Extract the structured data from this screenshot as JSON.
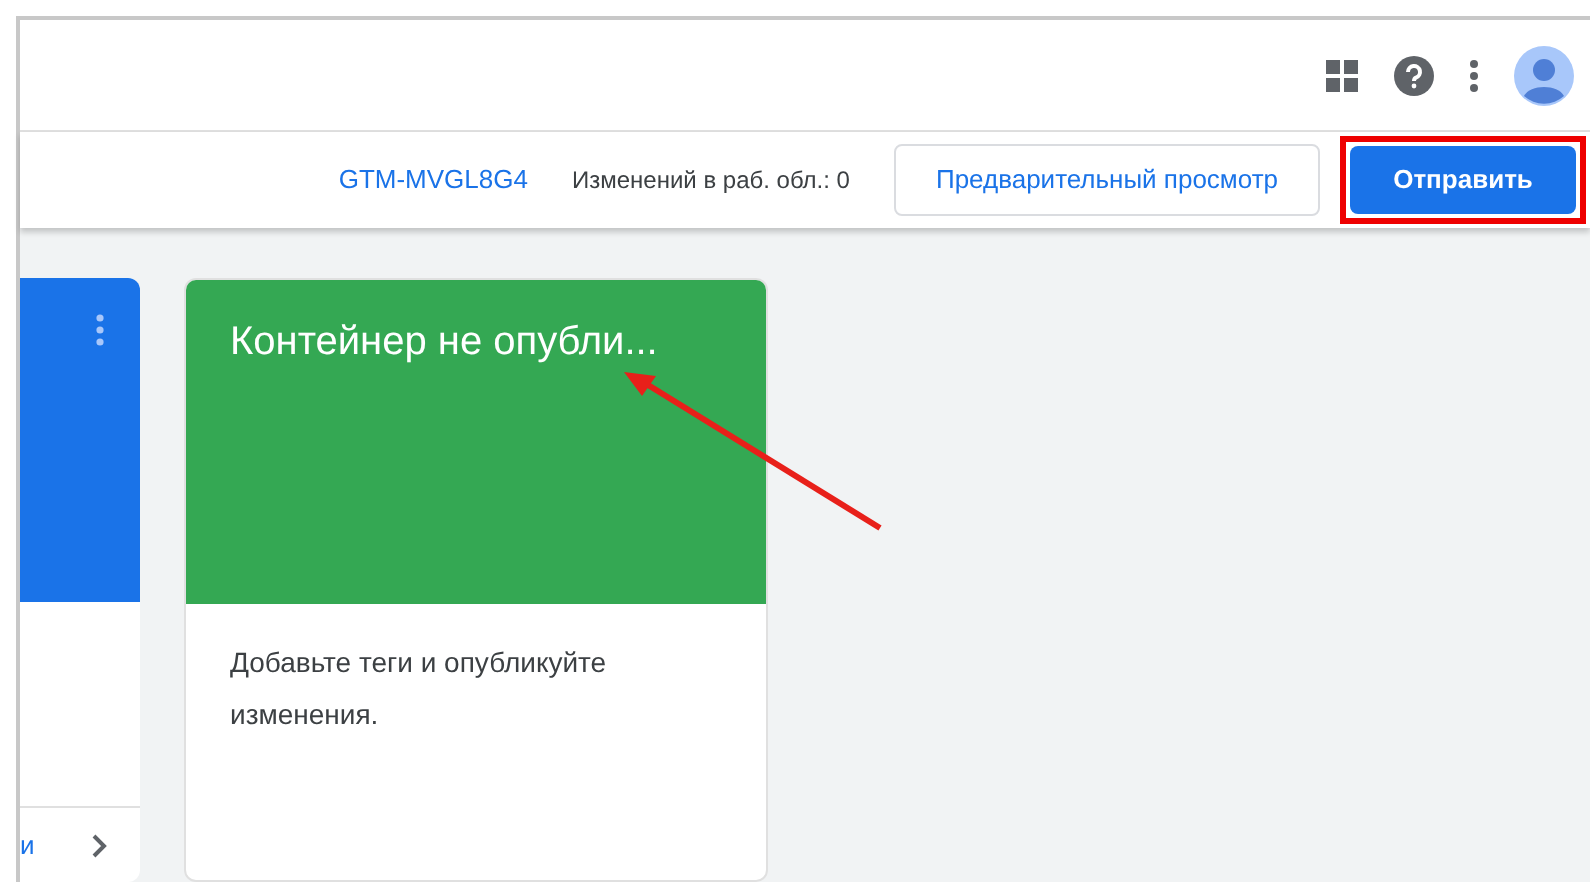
{
  "toolbar": {
    "container_id": "GTM-MVGL8G4",
    "changes": "Изменений в раб. обл.: 0",
    "preview_button": "Предварительный просмотр",
    "submit_button": "Отправить",
    "submit_highlighted": true
  },
  "cards": [
    {
      "kind": "partial",
      "color": "#1a73e8",
      "link": "и"
    },
    {
      "kind": "full",
      "color": "#34a853",
      "title": "Контейнер не опубли...",
      "body": "Добавьте теги и опубликуйте изменения.",
      "arrow_pointing": true
    }
  ]
}
